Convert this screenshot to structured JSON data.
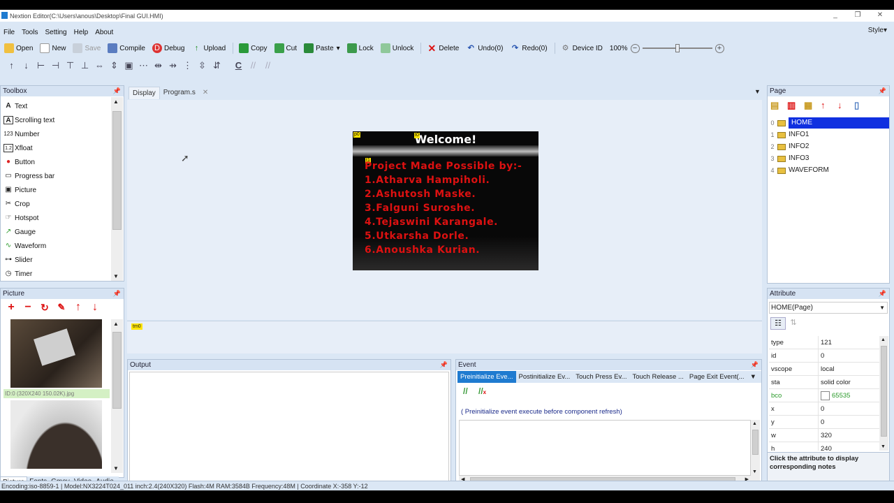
{
  "window": {
    "title": "Nextion Editor(C:\\Users\\anous\\Desktop\\Final GUI.HMI)",
    "minimize": "_",
    "maximize": "❐",
    "close": "✕"
  },
  "menu": {
    "items": [
      "File",
      "Tools",
      "Setting",
      "Help",
      "About"
    ],
    "style": "Style▾"
  },
  "toolbar": {
    "open": "Open",
    "new": "New",
    "save": "Save",
    "compile": "Compile",
    "debug": "Debug",
    "upload": "Upload",
    "copy": "Copy",
    "cut": "Cut",
    "paste": "Paste",
    "lock": "Lock",
    "unlock": "Unlock",
    "delete": "Delete",
    "undo": "Undo(0)",
    "redo": "Redo(0)",
    "device_id": "Device ID",
    "zoom": "100%",
    "zoom_level_percent": 50
  },
  "toolbox": {
    "title": "Toolbox",
    "items": [
      "Text",
      "Scrolling text",
      "Number",
      "Xfloat",
      "Button",
      "Progress bar",
      "Picture",
      "Crop",
      "Hotspot",
      "Gauge",
      "Waveform",
      "Slider",
      "Timer"
    ]
  },
  "picture_panel": {
    "title": "Picture",
    "selected_caption": "ID:0  (320X240 150.02K).jpg",
    "tabs": [
      "Picture",
      "Fonts",
      "Gmov",
      "Video",
      "Audio"
    ]
  },
  "doc_tabs": [
    "Display",
    "Program.s"
  ],
  "screen": {
    "title_chip": "t0",
    "p0_chip": "p0",
    "t1_chip": "t1",
    "welcome": "Welcome!",
    "lines": [
      "Project Made Possible by:-",
      "1.Atharva Hampiholi.",
      "2.Ashutosh Maske.",
      "3.Falguni Suroshe.",
      "4.Tejaswini Karangale.",
      "5.Utkarsha Dorle.",
      "6.Anoushka Kurian."
    ]
  },
  "timer_strip": {
    "chip": "tm0"
  },
  "output": {
    "title": "Output"
  },
  "event": {
    "title": "Event",
    "tabs": [
      "Preinitialize Eve...",
      "Postinitialize Ev...",
      "Touch Press Ev...",
      "Touch Release ...",
      "Page Exit Event(..."
    ],
    "note": "( Preinitialize event execute before component refresh)"
  },
  "page_panel": {
    "title": "Page",
    "pages": [
      {
        "num": "0",
        "name": "HOME"
      },
      {
        "num": "1",
        "name": "INFO1"
      },
      {
        "num": "2",
        "name": "INFO2"
      },
      {
        "num": "3",
        "name": "INFO3"
      },
      {
        "num": "4",
        "name": "WAVEFORM"
      }
    ]
  },
  "attribute_panel": {
    "title": "Attribute",
    "object": "HOME(Page)",
    "rows": [
      {
        "k": "type",
        "v": "121"
      },
      {
        "k": "id",
        "v": "0"
      },
      {
        "k": "vscope",
        "v": "local"
      },
      {
        "k": "sta",
        "v": "solid color"
      },
      {
        "k": "bco",
        "v": "65535"
      },
      {
        "k": "x",
        "v": "0"
      },
      {
        "k": "y",
        "v": "0"
      },
      {
        "k": "w",
        "v": "320"
      },
      {
        "k": "h",
        "v": "240"
      }
    ],
    "help": "Click the attribute to display corresponding notes"
  },
  "status": "Encoding:iso-8859-1 | Model:NX3224T024_011 inch:2.4(240X320) Flash:4M RAM:3584B Frequency:48M |   Coordinate X:-358  Y:-12",
  "colors": {
    "accent": "#1f7bd0",
    "selection": "#1030e0",
    "credit_text": "#dd1111",
    "chip": "#ffe500"
  }
}
